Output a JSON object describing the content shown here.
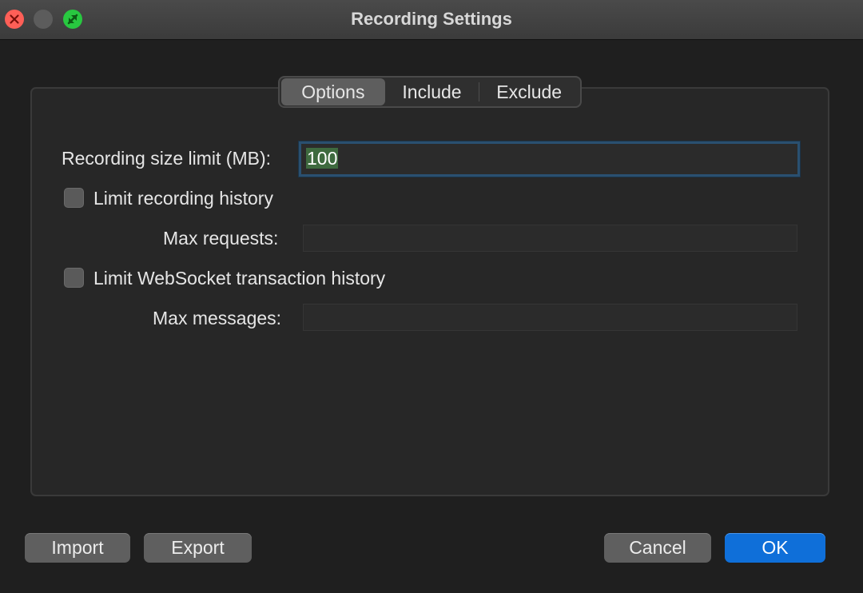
{
  "window": {
    "title": "Recording Settings"
  },
  "tabs": [
    {
      "label": "Options",
      "active": true
    },
    {
      "label": "Include",
      "active": false
    },
    {
      "label": "Exclude",
      "active": false
    }
  ],
  "options": {
    "size_limit_label": "Recording size limit (MB):",
    "size_limit_value": "100",
    "limit_history_label": "Limit recording history",
    "limit_history_checked": false,
    "max_requests_label": "Max requests:",
    "max_requests_value": "",
    "limit_ws_label": "Limit WebSocket transaction history",
    "limit_ws_checked": false,
    "max_messages_label": "Max messages:",
    "max_messages_value": ""
  },
  "buttons": {
    "import": "Import",
    "export": "Export",
    "cancel": "Cancel",
    "ok": "OK"
  },
  "colors": {
    "accent": "#0f6fd9",
    "close": "#ff5f57",
    "zoom": "#28c840"
  }
}
